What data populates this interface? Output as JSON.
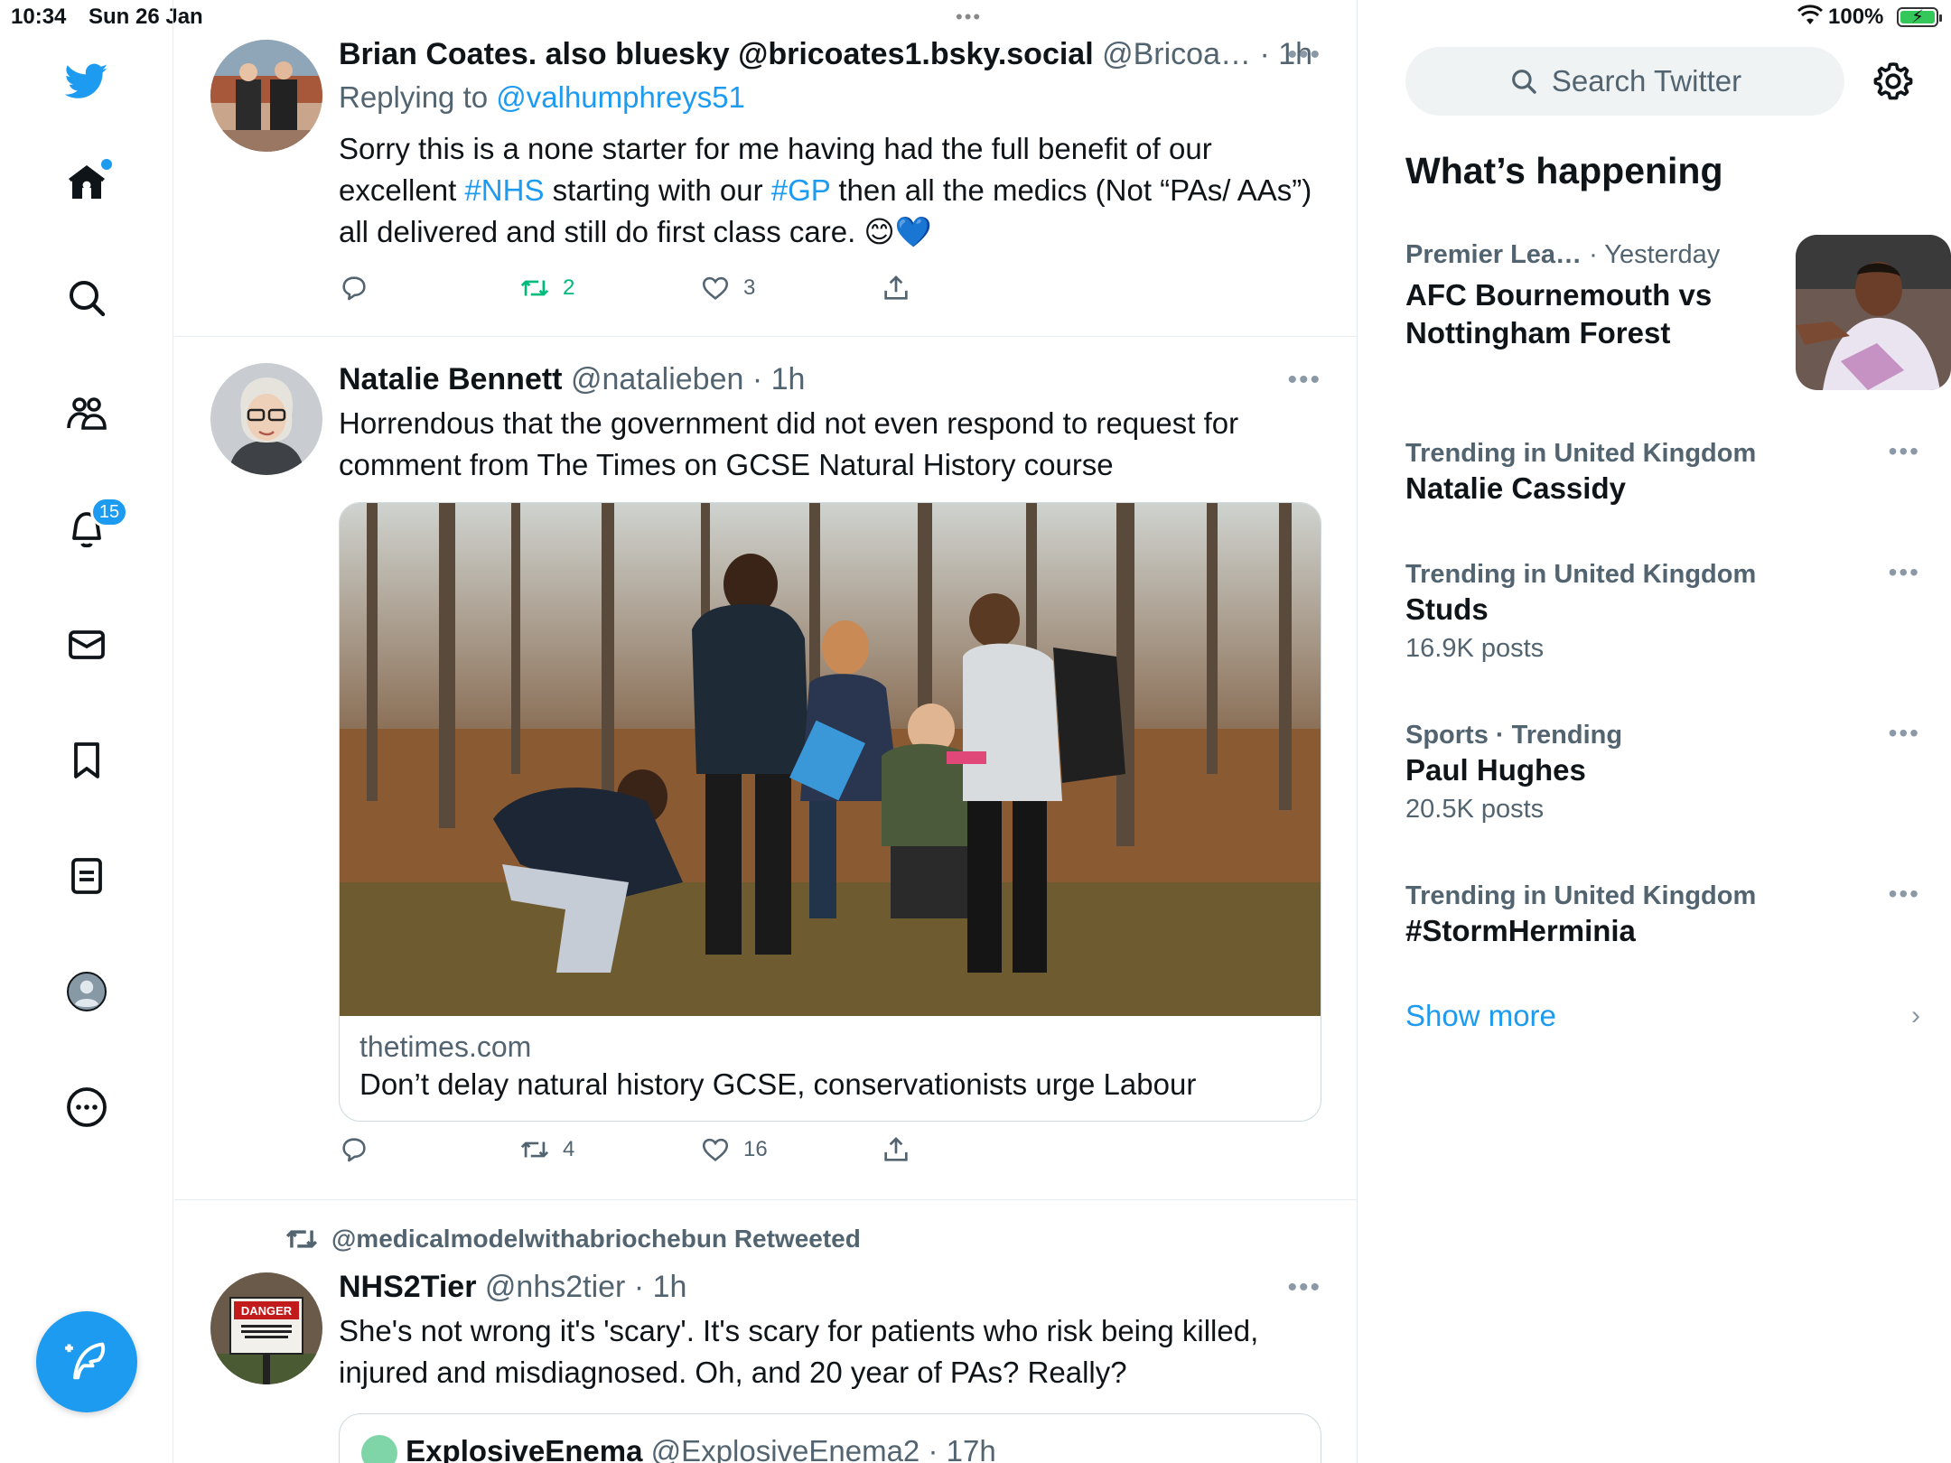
{
  "status_bar": {
    "time": "10:34",
    "date": "Sun 26 Jan",
    "battery": "100%",
    "multitask_dots": "•••"
  },
  "nav": {
    "notifications_badge": "15"
  },
  "tweets": [
    {
      "name": "Brian Coates. also bluesky @bricoates1.bsky.social",
      "handle": "@Bricoa…",
      "time": "1h",
      "replying_prefix": "Replying to ",
      "replying_to": "@valhumphreys51",
      "text_parts": [
        "Sorry this is a none starter for me having had the full benefit of our excellent ",
        "#NHS",
        " starting with our ",
        "#GP",
        " then all the medics (Not “PAs/ AAs”) all delivered and still do first class care. 😊💙"
      ],
      "replies": "",
      "retweets": "2",
      "likes": "3"
    },
    {
      "name": "Natalie Bennett",
      "handle": "@natalieben",
      "time": "1h",
      "text": "Horrendous that the government did not even respond to request for comment from The Times on GCSE Natural History course",
      "card": {
        "domain": "thetimes.com",
        "title": "Don’t delay natural history GCSE, conservationists urge Labour"
      },
      "replies": "",
      "retweets": "4",
      "likes": "16"
    },
    {
      "retweeted_by": "@medicalmodelwithabriochebun Retweeted",
      "name": "NHS2Tier",
      "handle": "@nhs2tier",
      "time": "1h",
      "text": "She's not wrong it's 'scary'. It's scary for patients who risk being killed, injured and misdiagnosed. Oh, and 20 year of PAs? Really?",
      "quoted": {
        "name": "ExplosiveEnema",
        "handle": "@ExplosiveEnema2",
        "time": "17h"
      },
      "avatar_sign": {
        "line1": "DANGER",
        "line2": "AUTHORIZED PERSONNEL ONLY BEYOND THIS POINT"
      }
    }
  ],
  "sidebar": {
    "search_placeholder": "Search Twitter",
    "title": "What’s happening",
    "trends": [
      {
        "context": "Premier Lea…",
        "context_time": "· Yesterday",
        "title": "AFC Bournemouth vs Nottingham Forest",
        "count": ""
      },
      {
        "context": "Trending in United Kingdom",
        "title": "Natalie Cassidy",
        "count": ""
      },
      {
        "context": "Trending in United Kingdom",
        "title": "Studs",
        "count": "16.9K posts"
      },
      {
        "context": "Sports · Trending",
        "title": "Paul Hughes",
        "count": "20.5K posts"
      },
      {
        "context": "Trending in United Kingdom",
        "title": "#StormHerminia",
        "count": ""
      }
    ],
    "show_more": "Show more"
  },
  "colors": {
    "accent": "#1d9bf0",
    "retweet_green": "#00ba7c",
    "secondary_text": "#536471",
    "border": "#e6ecf0"
  }
}
